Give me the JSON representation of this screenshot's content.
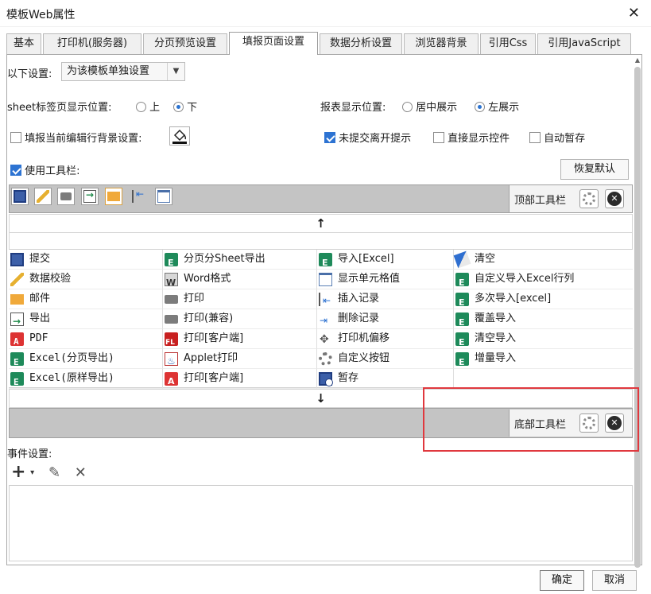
{
  "window": {
    "title": "模板Web属性"
  },
  "tabs": [
    {
      "label": "基本"
    },
    {
      "label": "打印机(服务器)"
    },
    {
      "label": "分页预览设置"
    },
    {
      "label": "填报页面设置"
    },
    {
      "label": "数据分析设置"
    },
    {
      "label": "浏览器背景"
    },
    {
      "label": "引用Css"
    },
    {
      "label": "引用JavaScript"
    }
  ],
  "settings": {
    "mode_label": "以下设置:",
    "mode_value": "为该模板单独设置",
    "sheet_pos_label": "sheet标签页显示位置:",
    "sheet_pos_top": "上",
    "sheet_pos_bottom": "下",
    "report_pos_label": "报表显示位置:",
    "report_pos_center": "居中展示",
    "report_pos_left": "左展示",
    "bg_setting": "填报当前编辑行背景设置:",
    "unsubmitted_prompt": "未提交离开提示",
    "direct_show": "直接显示控件",
    "auto_stash": "自动暂存",
    "use_toolbar": "使用工具栏:",
    "restore_default": "恢复默认"
  },
  "toolbar": {
    "top_label": "顶部工具栏",
    "bottom_label": "底部工具栏",
    "up_arrow": "↑",
    "down_arrow": "↓"
  },
  "buttons_grid": {
    "col1": [
      "提交",
      "数据校验",
      "邮件",
      "导出",
      "PDF",
      "Excel(分页导出)",
      "Excel(原样导出)"
    ],
    "col2": [
      "分页分Sheet导出",
      "Word格式",
      "打印",
      "打印(兼容)",
      "打印[客户端]",
      "Applet打印",
      "打印[客户端]"
    ],
    "col3": [
      "导入[Excel]",
      "显示单元格值",
      "插入记录",
      "删除记录",
      "打印机偏移",
      "自定义按钮",
      "暂存"
    ],
    "col4": [
      "清空",
      "自定义导入Excel行列",
      "多次导入[excel]",
      "覆盖导入",
      "清空导入",
      "增量导入"
    ]
  },
  "events": {
    "label": "事件设置:",
    "add": "+",
    "add_caret": "▾",
    "edit": "✎",
    "remove": "✕"
  },
  "footer": {
    "ok": "确定",
    "cancel": "取消"
  },
  "colors": {
    "accent": "#2d73d2",
    "highlight": "#e0383e",
    "strip": "#c4c4c4"
  }
}
